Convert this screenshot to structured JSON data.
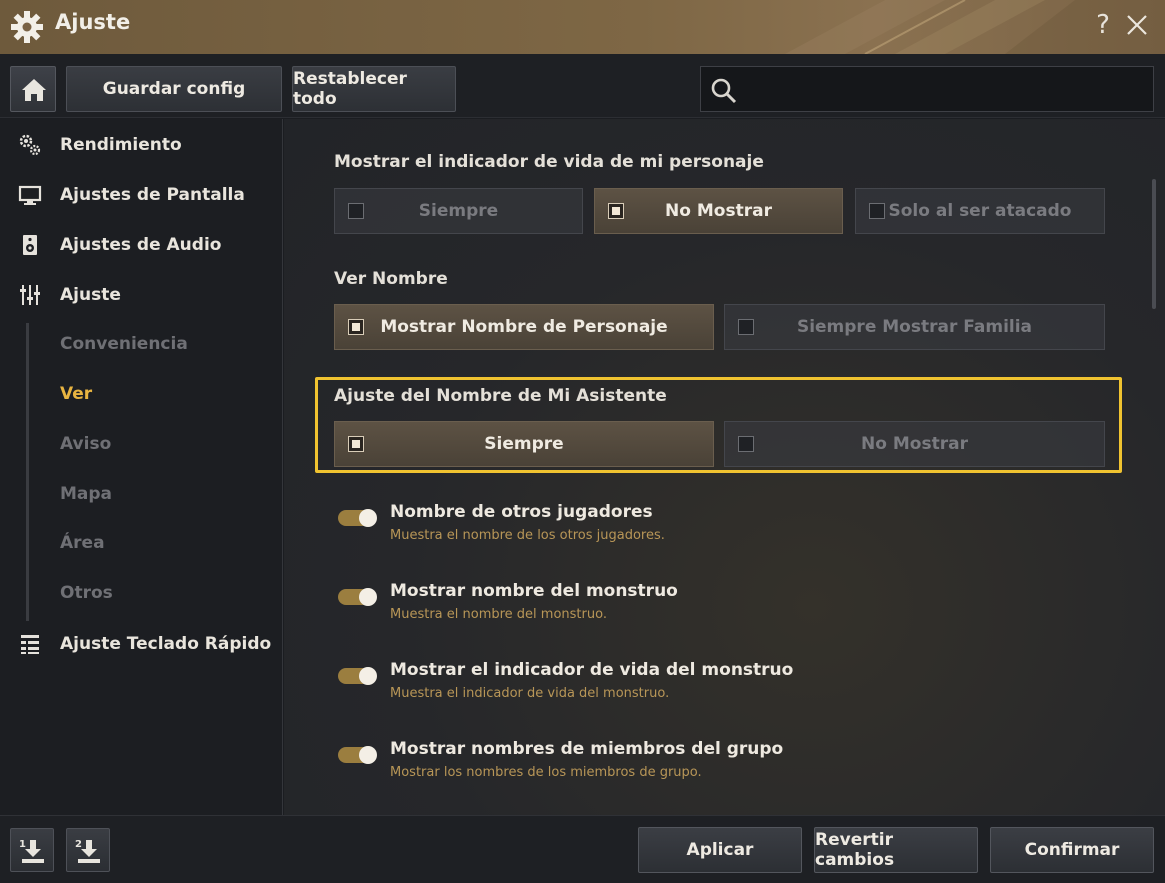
{
  "window": {
    "title": "Ajuste",
    "help_label": "?"
  },
  "toolbar": {
    "save_label": "Guardar config",
    "reset_label": "Restablecer todo",
    "search_placeholder": ""
  },
  "sidebar": {
    "items": [
      {
        "label": "Rendimiento",
        "icon": "gears-icon"
      },
      {
        "label": "Ajustes de Pantalla",
        "icon": "monitor-icon"
      },
      {
        "label": "Ajustes de Audio",
        "icon": "speaker-icon"
      },
      {
        "label": "Ajuste",
        "icon": "sliders-icon"
      },
      {
        "label": "Ajuste Teclado Rápido",
        "icon": "list-icon"
      }
    ],
    "subitems": [
      {
        "label": "Conveniencia"
      },
      {
        "label": "Ver",
        "active": true
      },
      {
        "label": "Aviso"
      },
      {
        "label": "Mapa"
      },
      {
        "label": "Área"
      },
      {
        "label": "Otros"
      }
    ]
  },
  "main": {
    "sections": [
      {
        "title": "Mostrar el indicador de vida de mi personaje",
        "options": [
          {
            "label": "Siempre",
            "selected": false
          },
          {
            "label": "No Mostrar",
            "selected": true
          },
          {
            "label": "Solo al ser atacado",
            "selected": false
          }
        ]
      },
      {
        "title": "Ver Nombre",
        "options": [
          {
            "label": "Mostrar Nombre de Personaje",
            "selected": true
          },
          {
            "label": "Siempre Mostrar Familia",
            "selected": false
          }
        ]
      },
      {
        "title": "Ajuste del Nombre de Mi Asistente",
        "options": [
          {
            "label": "Siempre",
            "selected": true
          },
          {
            "label": "No Mostrar",
            "selected": false
          }
        ]
      }
    ],
    "toggles": [
      {
        "title": "Nombre de otros jugadores",
        "desc": "Muestra el nombre de los otros jugadores.",
        "on": true
      },
      {
        "title": "Mostrar nombre del monstruo",
        "desc": "Muestra el nombre del monstruo.",
        "on": true
      },
      {
        "title": "Mostrar el indicador de vida del monstruo",
        "desc": "Muestra el indicador de vida del monstruo.",
        "on": true
      },
      {
        "title": "Mostrar nombres de miembros del grupo",
        "desc": "Mostrar los nombres de los miembros de grupo.",
        "on": true
      }
    ]
  },
  "footer": {
    "slot1_label": "1",
    "slot2_label": "2",
    "apply_label": "Aplicar",
    "revert_label": "Revertir cambios",
    "confirm_label": "Confirmar"
  },
  "colors": {
    "accent": "#e8b441",
    "highlight": "#f0c330",
    "toggle_on": "#9b7e3f"
  }
}
